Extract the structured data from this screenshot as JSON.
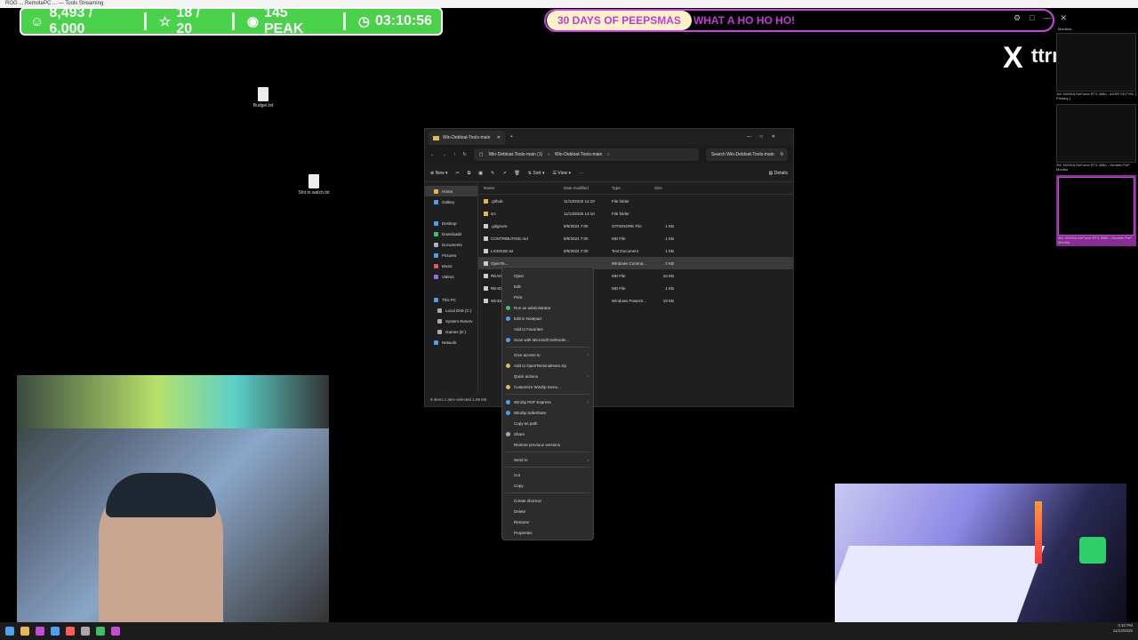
{
  "topbar": {
    "title": "ROG ... RemotePC ... — Tools Streaming"
  },
  "stats": {
    "followers": "8,493 / 6,000",
    "stars": "18 / 20",
    "peak": "145 PEAK",
    "timer": "03:10:56"
  },
  "banner": {
    "pill": "30 DAYS OF PEEPSMAS",
    "rest": "WHAT A HO HO HO!"
  },
  "brand": {
    "x": "X",
    "handle": "ttrmsp"
  },
  "desktop": {
    "icon1": "Budget.txt",
    "icon2": "Shit to watch.txt"
  },
  "explorer": {
    "tab_title": "Win-Debloat-Tools-main",
    "breadcrumb": [
      "Win-Debloat-Tools-main (1)",
      "Win-Debloat-Tools-main"
    ],
    "search_placeholder": "Search Win-Debloat-Tools-main",
    "toolbar": {
      "new": "New",
      "sort": "Sort",
      "view": "View",
      "details": "Details"
    },
    "nav": [
      "Home",
      "Gallery",
      "Desktop",
      "Downloads",
      "Documents",
      "Pictures",
      "Music",
      "Videos",
      "This PC",
      "Local Disk (C:)",
      "System Reserv",
      "Games (E:)",
      "Network"
    ],
    "columns": {
      "name": "Name",
      "date": "Date modified",
      "type": "Type",
      "size": "Size"
    },
    "files": [
      {
        "name": ".github",
        "date": "11/13/2025 14:10",
        "type": "File folder",
        "size": ""
      },
      {
        "name": "src",
        "date": "11/13/2025 14:10",
        "type": "File folder",
        "size": ""
      },
      {
        "name": ".gitignore",
        "date": "9/9/2024 7:00",
        "type": "GITIGNORE File",
        "size": "1 KB"
      },
      {
        "name": "CONTRIBUTING.md",
        "date": "9/9/2024 7:00",
        "type": "MD File",
        "size": "1 KB"
      },
      {
        "name": "LICENSE.txt",
        "date": "9/9/2024 7:00",
        "type": "Text Document",
        "size": "1 KB"
      },
      {
        "name": "OpenTe...",
        "date": "",
        "type": "Windows Comma...",
        "size": "2 KB"
      },
      {
        "name": "README...",
        "date": "",
        "type": "MD File",
        "size": "16 KB"
      },
      {
        "name": "README...",
        "date": "",
        "type": "MD File",
        "size": "1 KB"
      },
      {
        "name": "WinDe...",
        "date": "",
        "type": "Windows PowerS...",
        "size": "19 KB"
      }
    ],
    "status": "9 items   1 item selected  1.96 KB"
  },
  "context_menu": {
    "items": [
      "Open",
      "Edit",
      "Print",
      "Run as administrator",
      "Edit in Notepad",
      "Add to Favorites",
      "Scan with Microsoft Defender...",
      "Give access to",
      "Add to OpenTerminalHere.zip",
      "Quick actions",
      "Customize WinZip menu...",
      "WinZip PDF Express",
      "WinZip SafeShare",
      "Copy as path",
      "Share",
      "Restore previous versions",
      "Send to",
      "Cut",
      "Copy",
      "Create shortcut",
      "Delete",
      "Rename",
      "Properties"
    ]
  },
  "monitors": {
    "label": "Monitors",
    "list": [
      "1M: NVIDIA GeForce RTX 3080 - ACER SD7YHL [ Primary ]",
      "2M: NVIDIA GeForce RTX 3080 - Generic PnP Monitor",
      "3M: NVIDIA GeForce RTX 3080 - Generic PnP Monitor"
    ]
  },
  "clock": {
    "time": "3:10 PM",
    "date": "11/13/2025"
  },
  "colors": {
    "stats_green": "#49d24a",
    "banner_purple": "#c64ad8"
  }
}
